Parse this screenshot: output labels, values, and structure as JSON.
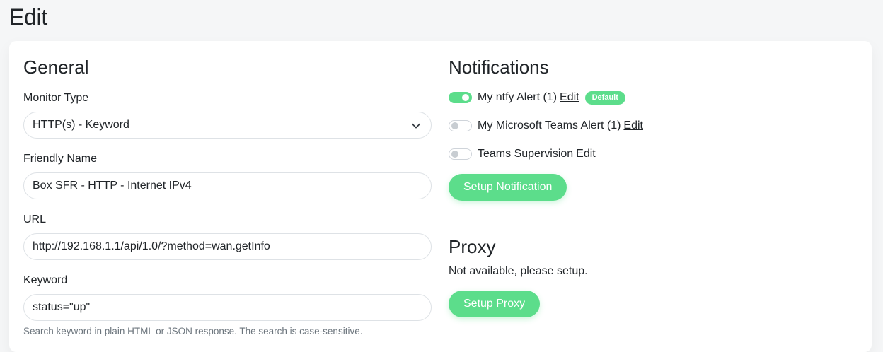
{
  "page": {
    "title": "Edit"
  },
  "general": {
    "heading": "General",
    "monitor_type": {
      "label": "Monitor Type",
      "value": "HTTP(s) - Keyword"
    },
    "friendly_name": {
      "label": "Friendly Name",
      "value": "Box SFR - HTTP - Internet IPv4"
    },
    "url": {
      "label": "URL",
      "value": "http://192.168.1.1/api/1.0/?method=wan.getInfo"
    },
    "keyword": {
      "label": "Keyword",
      "value": "status=\"up\"",
      "hint": "Search keyword in plain HTML or JSON response. The search is case-sensitive."
    }
  },
  "notifications": {
    "heading": "Notifications",
    "items": [
      {
        "name": "My ntfy Alert (1)",
        "edit": "Edit",
        "enabled": true,
        "badge": "Default"
      },
      {
        "name": "My Microsoft Teams Alert (1)",
        "edit": "Edit",
        "enabled": false
      },
      {
        "name": "Teams Supervision",
        "edit": "Edit",
        "enabled": false
      }
    ],
    "setup_button": "Setup Notification"
  },
  "proxy": {
    "heading": "Proxy",
    "status_text": "Not available, please setup.",
    "setup_button": "Setup Proxy"
  },
  "colors": {
    "accent": "#5cdd8b",
    "page_bg": "#f5f6f7",
    "card_bg": "#ffffff"
  },
  "icons": {
    "select_arrow": "chevron-down-icon"
  }
}
